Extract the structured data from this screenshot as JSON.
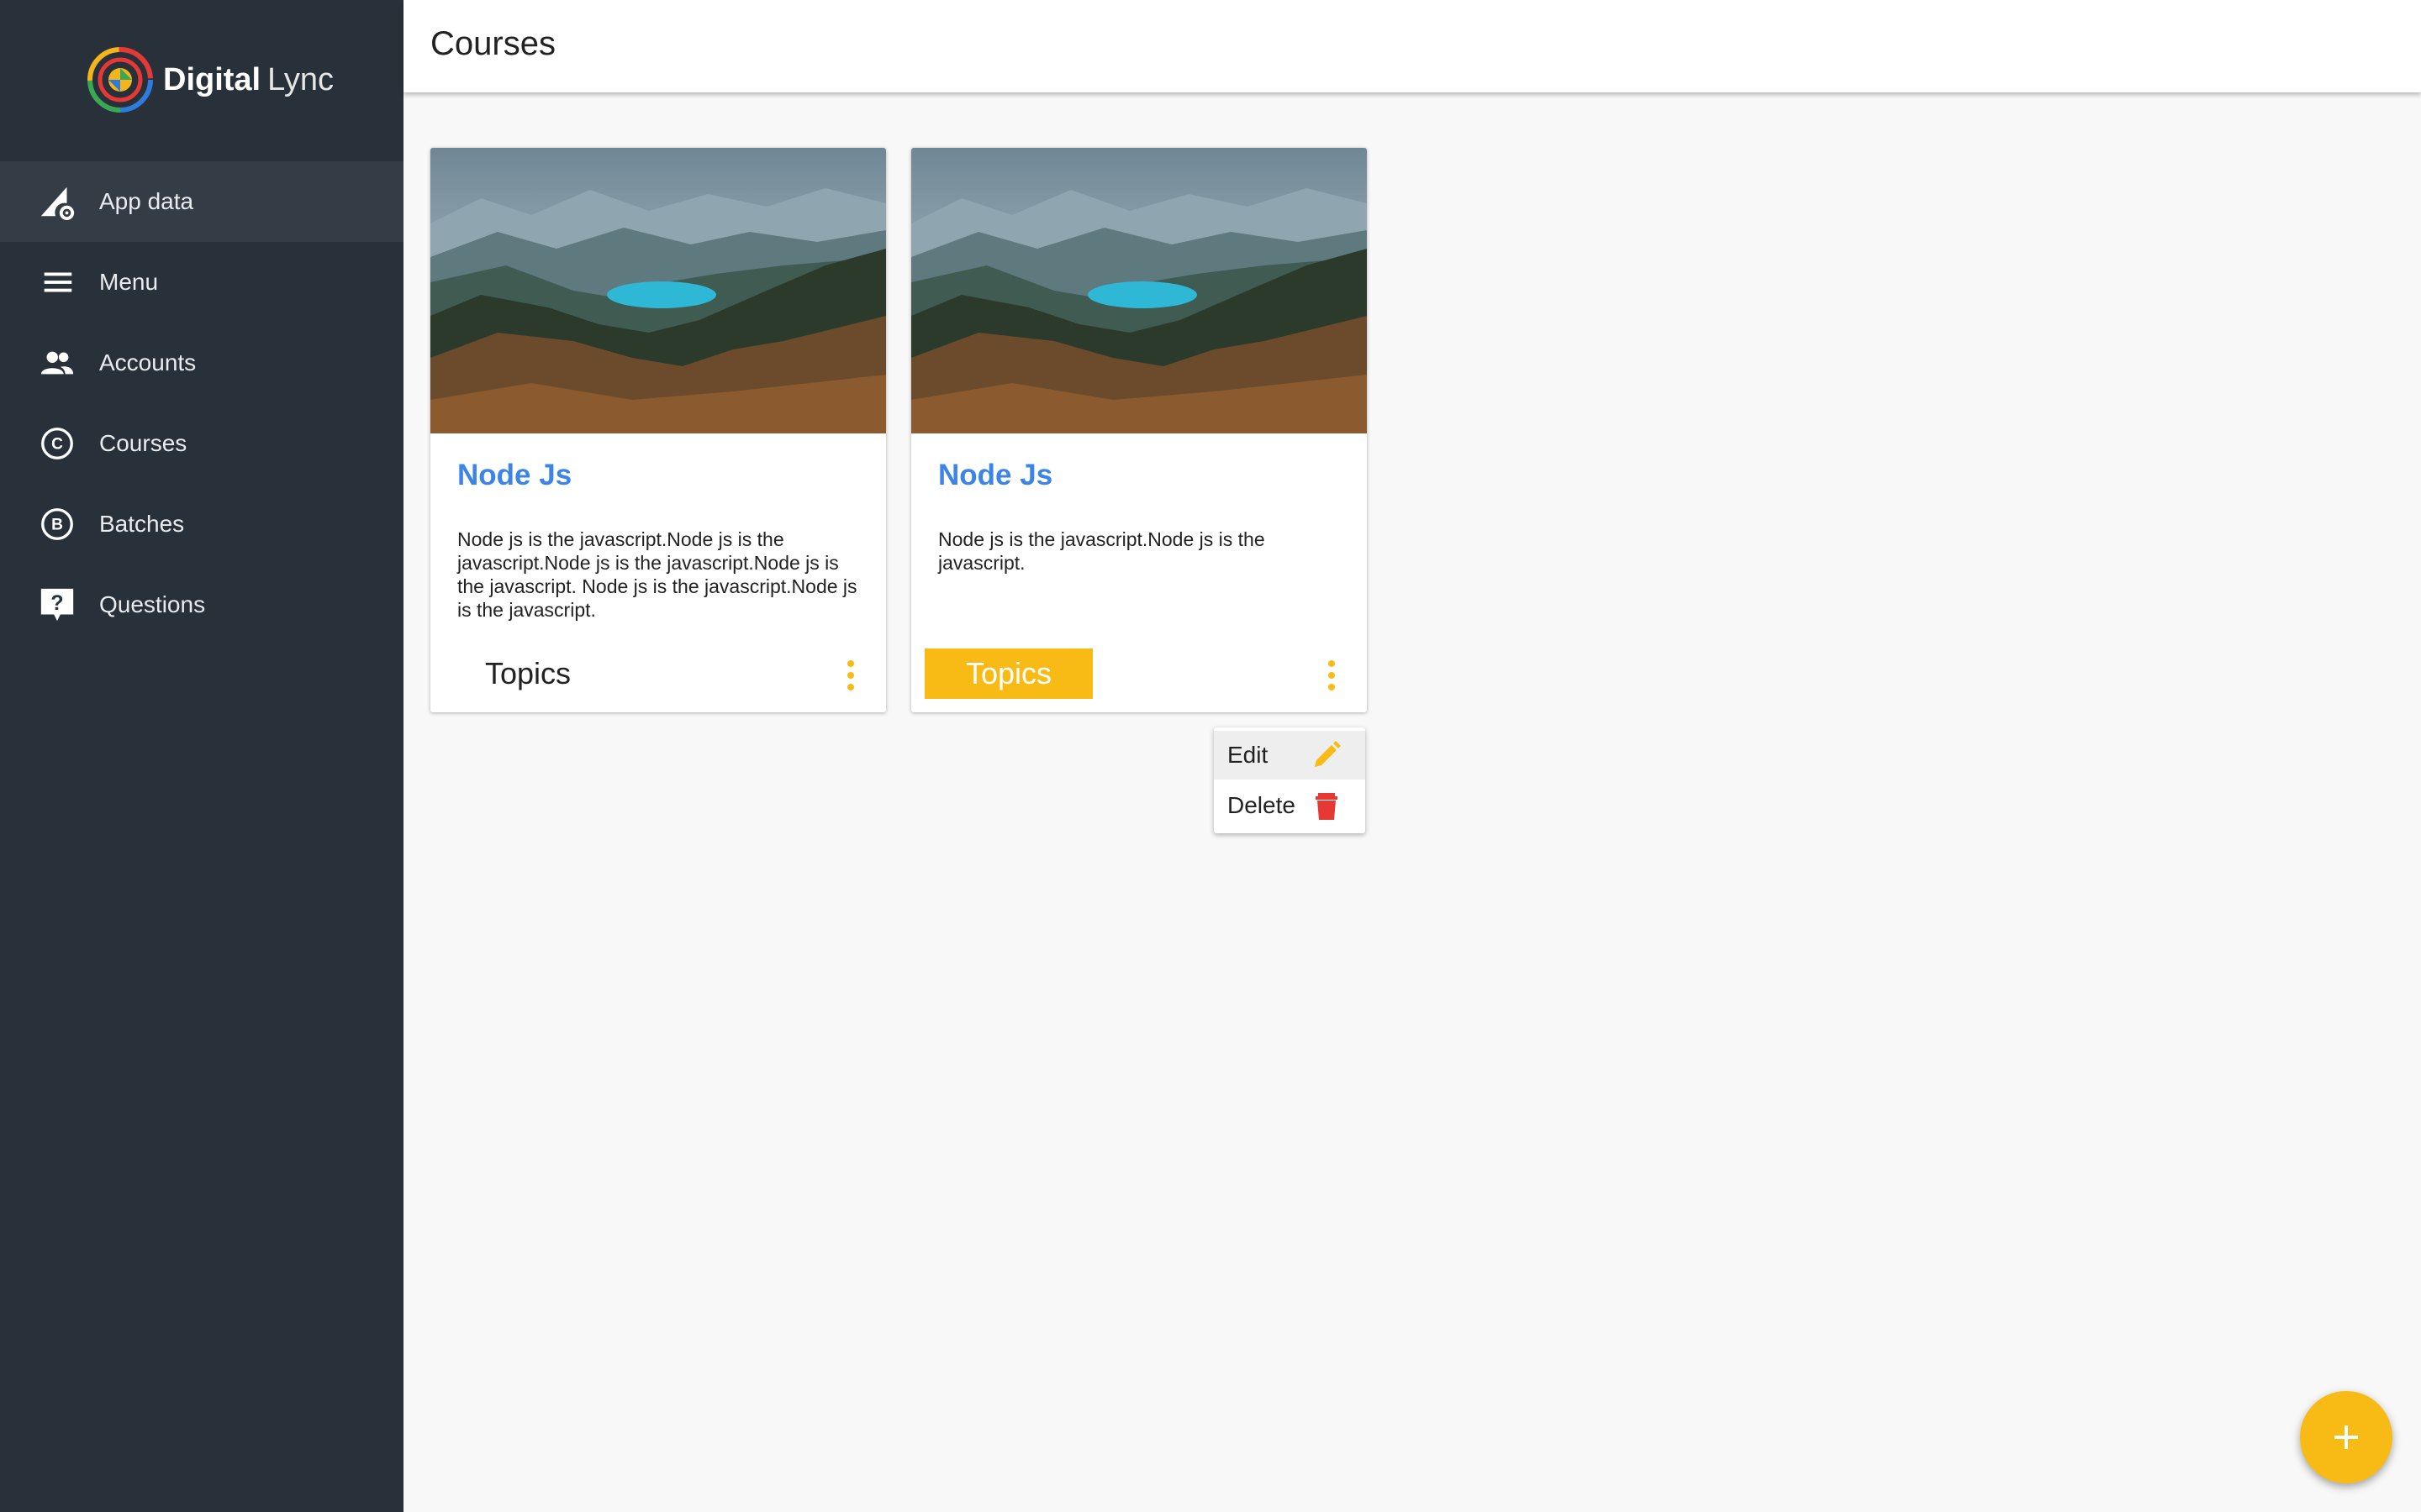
{
  "brand": {
    "name_bold": "Digital",
    "name_light": "Lync"
  },
  "sidebar": {
    "items": [
      {
        "label": "App data",
        "icon": "app-data-icon",
        "active": true
      },
      {
        "label": "Menu",
        "icon": "menu-icon"
      },
      {
        "label": "Accounts",
        "icon": "accounts-icon"
      },
      {
        "label": "Courses",
        "icon": "courses-icon"
      },
      {
        "label": "Batches",
        "icon": "batches-icon"
      },
      {
        "label": "Questions",
        "icon": "questions-icon"
      }
    ]
  },
  "header": {
    "title": "Courses"
  },
  "courses": [
    {
      "title": "Node Js",
      "description": "Node js is the javascript.Node js is the javascript.Node js is the javascript.Node js is the javascript. Node js is the javascript.Node js is the javascript.",
      "topics_label": "Topics",
      "topics_highlighted": false
    },
    {
      "title": "Node Js",
      "description": "Node js is the javascript.Node js is the javascript.",
      "topics_label": "Topics",
      "topics_highlighted": true
    }
  ],
  "context_menu": {
    "items": [
      {
        "label": "Edit",
        "icon": "pencil-icon",
        "color": "#f8bb16"
      },
      {
        "label": "Delete",
        "icon": "trash-icon",
        "color": "#e53935"
      }
    ]
  },
  "fab": {
    "icon": "plus-icon",
    "color": "#f8bb16"
  },
  "colors": {
    "sidebar_bg": "#283039",
    "accent": "#f8bb16",
    "title_blue": "#3c84e6"
  }
}
